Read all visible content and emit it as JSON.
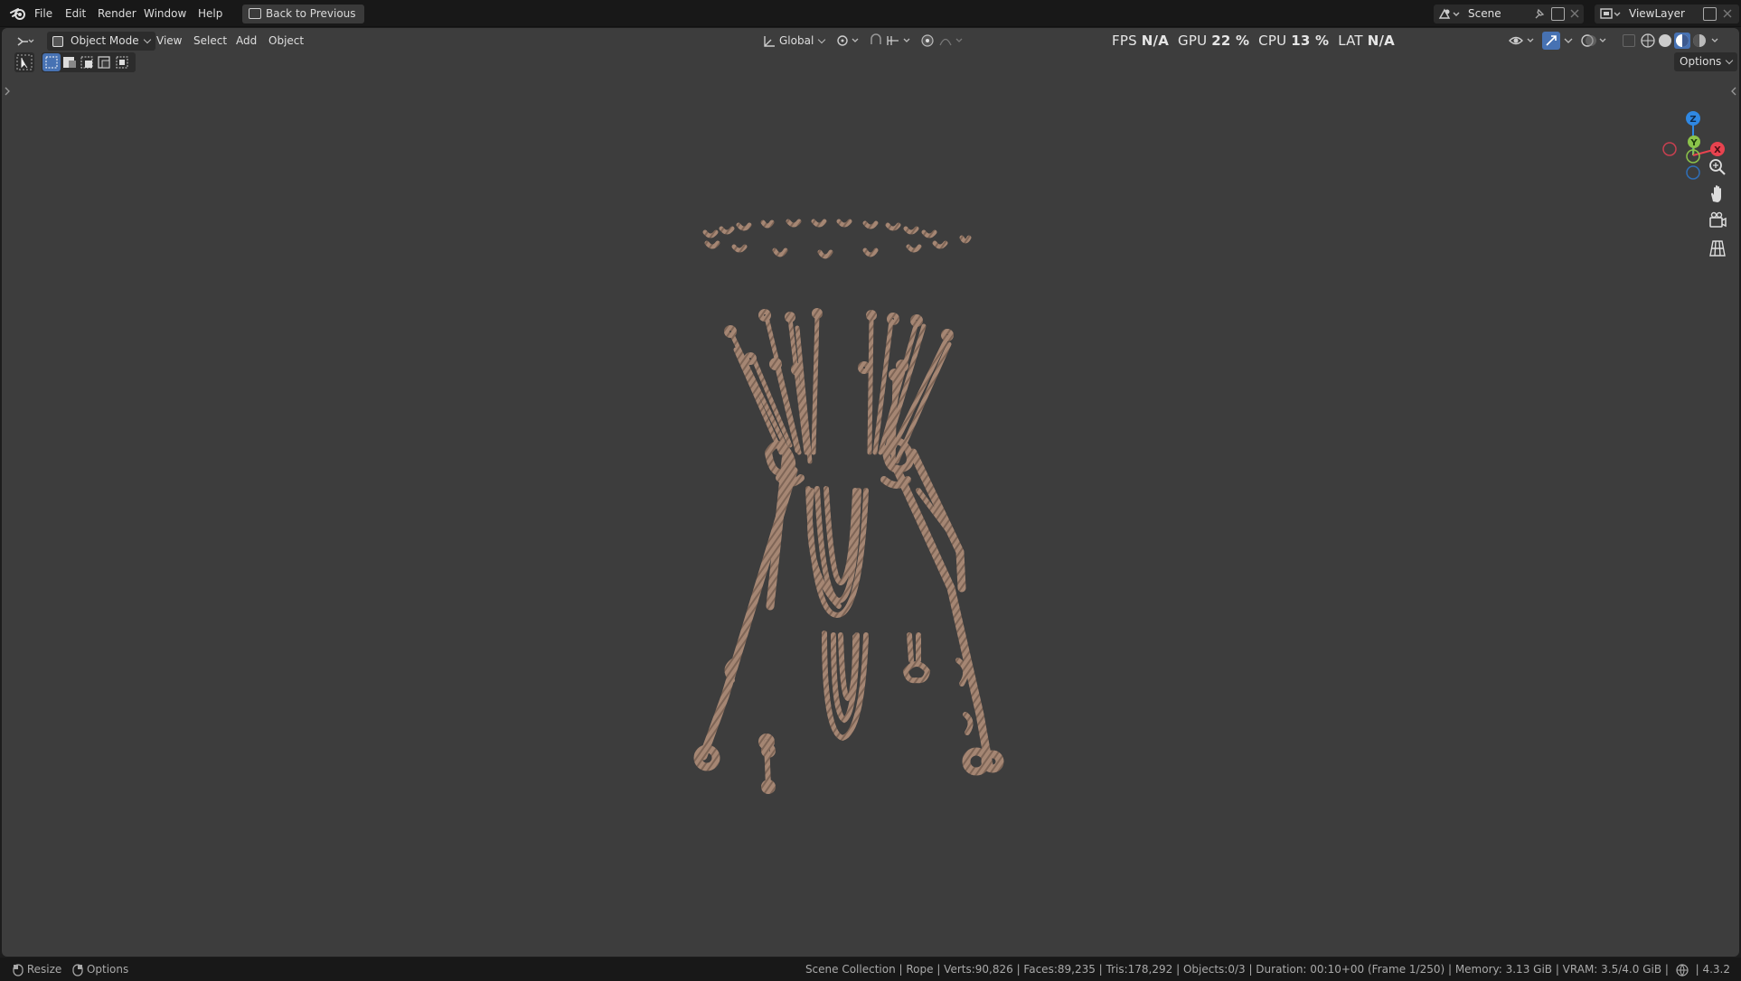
{
  "menu": {
    "items": [
      "File",
      "Edit",
      "Render",
      "Window",
      "Help"
    ],
    "back_button": "Back to Previous"
  },
  "scene_selector": {
    "label": "Scene"
  },
  "viewlayer_selector": {
    "label": "ViewLayer"
  },
  "viewport_header": {
    "mode": "Object Mode",
    "menus": [
      "View",
      "Select",
      "Add",
      "Object"
    ],
    "transform_orientation": "Global",
    "options_label": "Options"
  },
  "stats": {
    "fps_label": "FPS",
    "fps_value": "N/A",
    "gpu_label": "GPU",
    "gpu_value": "22 %",
    "cpu_label": "CPU",
    "cpu_value": "13 %",
    "lat_label": "LAT",
    "lat_value": "N/A"
  },
  "gizmo": {
    "axes": [
      "Z",
      "Y",
      "X"
    ],
    "colors": {
      "x": "#e8434f",
      "y": "#8bc34a",
      "z": "#2f88e3"
    }
  },
  "statusbar": {
    "left_items": [
      "Resize",
      "Options"
    ],
    "right_text": "Scene Collection | Rope | Verts:90,826 | Faces:89,235 | Tris:178,292 | Objects:0/3 | Duration: 00:10+00 (Frame 1/250) | Memory: 3.13 GiB | VRAM: 3.5/4.0 GiB |",
    "version": "4.3.2"
  },
  "colors": {
    "viewport_bg": "#3d3d3d",
    "rope": "#a58673",
    "accent_blue": "#4772b3"
  }
}
